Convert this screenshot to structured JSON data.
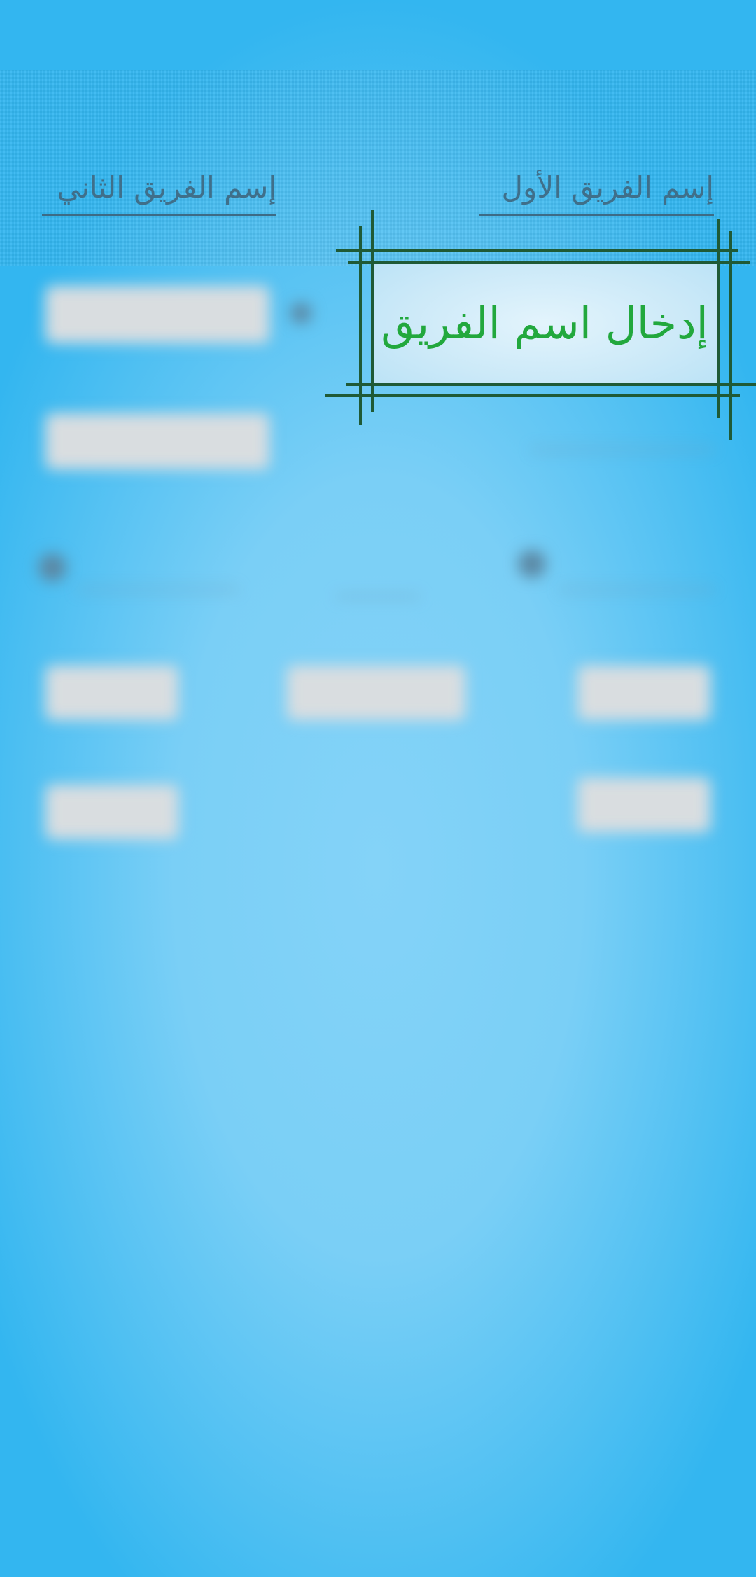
{
  "team_names": {
    "first_placeholder": "إسم الفريق الأول",
    "second_placeholder": "إسم الفريق الثاني"
  },
  "tooltip": {
    "label": "إدخال اسم الفريق",
    "text_color": "#22a83d",
    "frame_color": "#1f5a36"
  },
  "colors": {
    "background": "#33b6f0",
    "background_center": "#84d3f8",
    "input_text": "#3f6f8a"
  }
}
